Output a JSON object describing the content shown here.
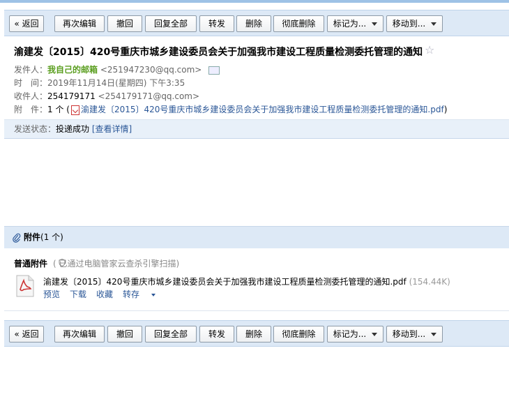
{
  "toolbar": {
    "back": "« 返回",
    "edit_again": "再次编辑",
    "recall": "撤回",
    "reply_all": "回复全部",
    "forward": "转发",
    "delete": "删除",
    "delete_permanently": "彻底删除",
    "mark_as": "标记为...",
    "move_to": "移动到..."
  },
  "email": {
    "subject": "渝建发〔2015〕420号重庆市城乡建设委员会关于加强我市建设工程质量检测委托管理的通知",
    "sender_label": "发件人：",
    "sender_name": "我自己的邮箱",
    "sender_email": "<251947230@qq.com>",
    "time_label": "时　间：",
    "time_value": "2019年11月14日(星期四) 下午3:35",
    "to_label": "收件人：",
    "to_name": "254179171",
    "to_email": "<254179171@qq.com>",
    "attach_label": "附　件：",
    "attach_count": "1 个",
    "attach_paren_open": " (",
    "attach_name": "渝建发〔2015〕420号重庆市城乡建设委员会关于加强我市建设工程质量检测委托管理的通知.pdf",
    "attach_paren_close": ")",
    "status_label": "发送状态：",
    "status_value": "投递成功",
    "status_detail": "[查看详情]"
  },
  "attachments": {
    "title": "附件",
    "count": "(1 个)",
    "normal_label": "普通附件",
    "scan_text": "(  已通过电脑管家云查杀引擎扫描)",
    "file_name": "渝建发〔2015〕420号重庆市城乡建设委员会关于加强我市建设工程质量检测委托管理的通知.pdf",
    "file_size": "(154.44K)",
    "preview": "预览",
    "download": "下载",
    "collect": "收藏",
    "save_to": "转存"
  },
  "icons": [
    "star-icon",
    "contact-card-icon",
    "pdf-icon",
    "paperclip-icon",
    "shield-icon",
    "dropdown-arrow-icon"
  ],
  "colors": {
    "toolbar_bg": "#dde9f6",
    "link": "#2b5797",
    "sender_green": "#5a9e1f",
    "pdf_red": "#cc3333"
  }
}
